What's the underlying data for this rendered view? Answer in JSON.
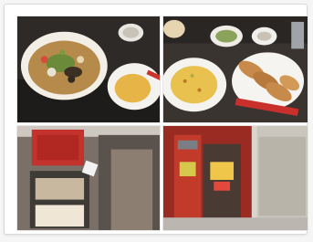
{
  "gallery": {
    "images": [
      {
        "subject": "noodle-soup-and-omelet-rice"
      },
      {
        "subject": "fried-rice-and-gyoza"
      },
      {
        "subject": "restaurant-sign-and-menu-display"
      },
      {
        "subject": "red-storefront-hallway"
      }
    ]
  }
}
